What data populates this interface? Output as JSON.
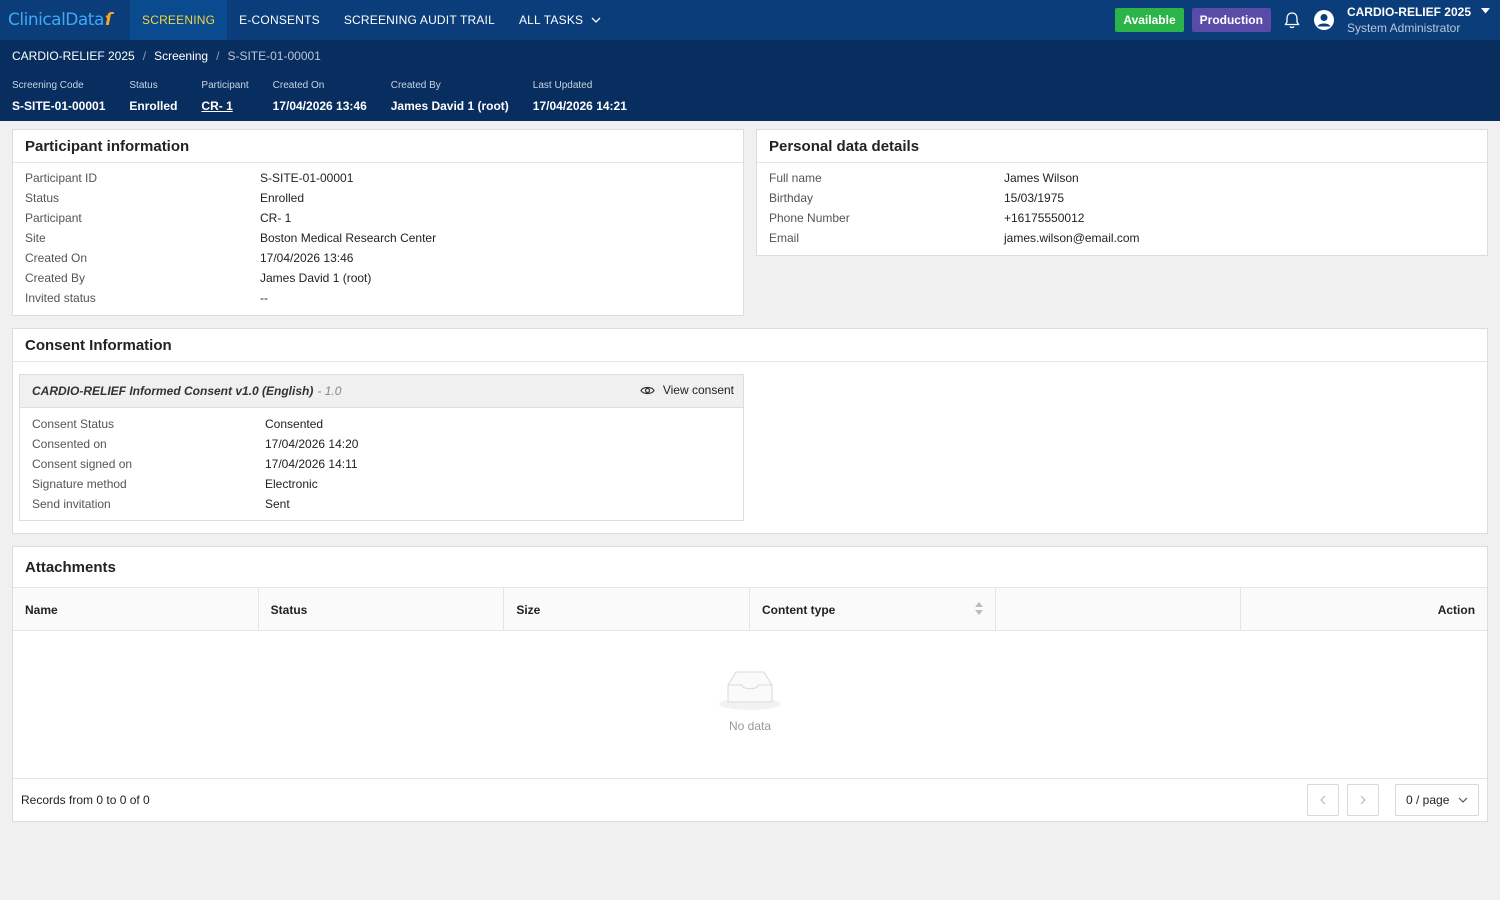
{
  "app": {
    "logo_text": "ClinicalData",
    "nav": [
      "SCREENING",
      "E-CONSENTS",
      "SCREENING AUDIT TRAIL",
      "ALL TASKS"
    ],
    "tag_available": "Available",
    "tag_production": "Production",
    "study_name": "CARDIO-RELIEF 2025",
    "user_role": "System Administrator"
  },
  "breadcrumb": [
    "CARDIO-RELIEF 2025",
    "Screening",
    "S-SITE-01-00001"
  ],
  "header_meta": [
    {
      "label": "Screening Code",
      "value": "S-SITE-01-00001"
    },
    {
      "label": "Status",
      "value": "Enrolled"
    },
    {
      "label": "Participant",
      "value": "CR- 1"
    },
    {
      "label": "Created On",
      "value": "17/04/2026 13:46"
    },
    {
      "label": "Created By",
      "value": "James David 1 (root)"
    },
    {
      "label": "Last Updated",
      "value": "17/04/2026 14:21"
    }
  ],
  "participant_info": {
    "title": "Participant information",
    "rows": [
      {
        "k": "Participant ID",
        "v": "S-SITE-01-00001"
      },
      {
        "k": "Status",
        "v": "Enrolled"
      },
      {
        "k": "Participant",
        "v": "CR- 1"
      },
      {
        "k": "Site",
        "v": "Boston Medical Research Center"
      },
      {
        "k": "Created On",
        "v": "17/04/2026 13:46"
      },
      {
        "k": "Created By",
        "v": "James David 1 (root)"
      },
      {
        "k": "Invited status",
        "v": "--"
      }
    ]
  },
  "personal_data": {
    "title": "Personal data details",
    "rows": [
      {
        "k": "Full name",
        "v": "James Wilson"
      },
      {
        "k": "Birthday",
        "v": "15/03/1975"
      },
      {
        "k": "Phone Number",
        "v": "+16175550012"
      },
      {
        "k": "Email",
        "v": "james.wilson@email.com"
      }
    ]
  },
  "consent": {
    "title": "Consent Information",
    "form_title": "CARDIO-RELIEF Informed Consent v1.0 (English)",
    "form_version": "- 1.0",
    "view_label": "View consent",
    "rows": [
      {
        "k": "Consent Status",
        "v": "Consented"
      },
      {
        "k": "Consented on",
        "v": "17/04/2026 14:20"
      },
      {
        "k": "Consent signed on",
        "v": "17/04/2026 14:11"
      },
      {
        "k": "Signature method",
        "v": "Electronic"
      },
      {
        "k": "Send invitation",
        "v": "Sent"
      }
    ]
  },
  "attachments": {
    "title": "Attachments",
    "columns": [
      "Name",
      "Status",
      "Size",
      "Content type",
      "",
      "Action"
    ],
    "empty_text": "No data",
    "records_text": "Records from 0 to 0 of 0",
    "page_size": "0 / page"
  }
}
